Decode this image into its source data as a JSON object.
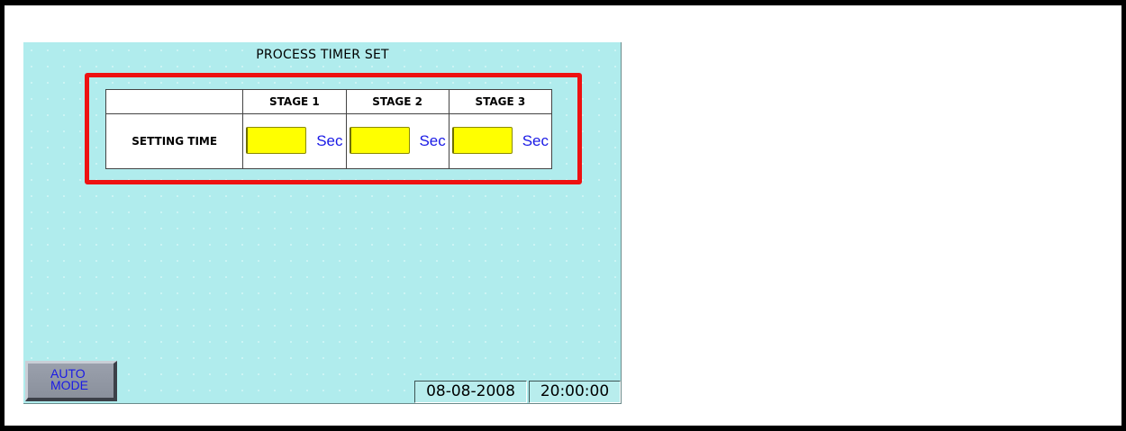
{
  "screen": {
    "title": "PROCESS TIMER SET",
    "background_color": "#b0eced",
    "highlight_color": "#ee1111"
  },
  "timer_table": {
    "columns": [
      "",
      "STAGE 1",
      "STAGE 2",
      "STAGE 3"
    ],
    "row_label": "SETTING TIME",
    "stages": [
      {
        "value": "",
        "unit": "Sec"
      },
      {
        "value": "",
        "unit": "Sec"
      },
      {
        "value": "",
        "unit": "Sec"
      }
    ],
    "field_color": "#ffff00",
    "unit_color": "#1a1ae6"
  },
  "mode_button": {
    "line1": "AUTO",
    "line2": "MODE"
  },
  "clock": {
    "date": "08-08-2008",
    "time": "20:00:00"
  }
}
